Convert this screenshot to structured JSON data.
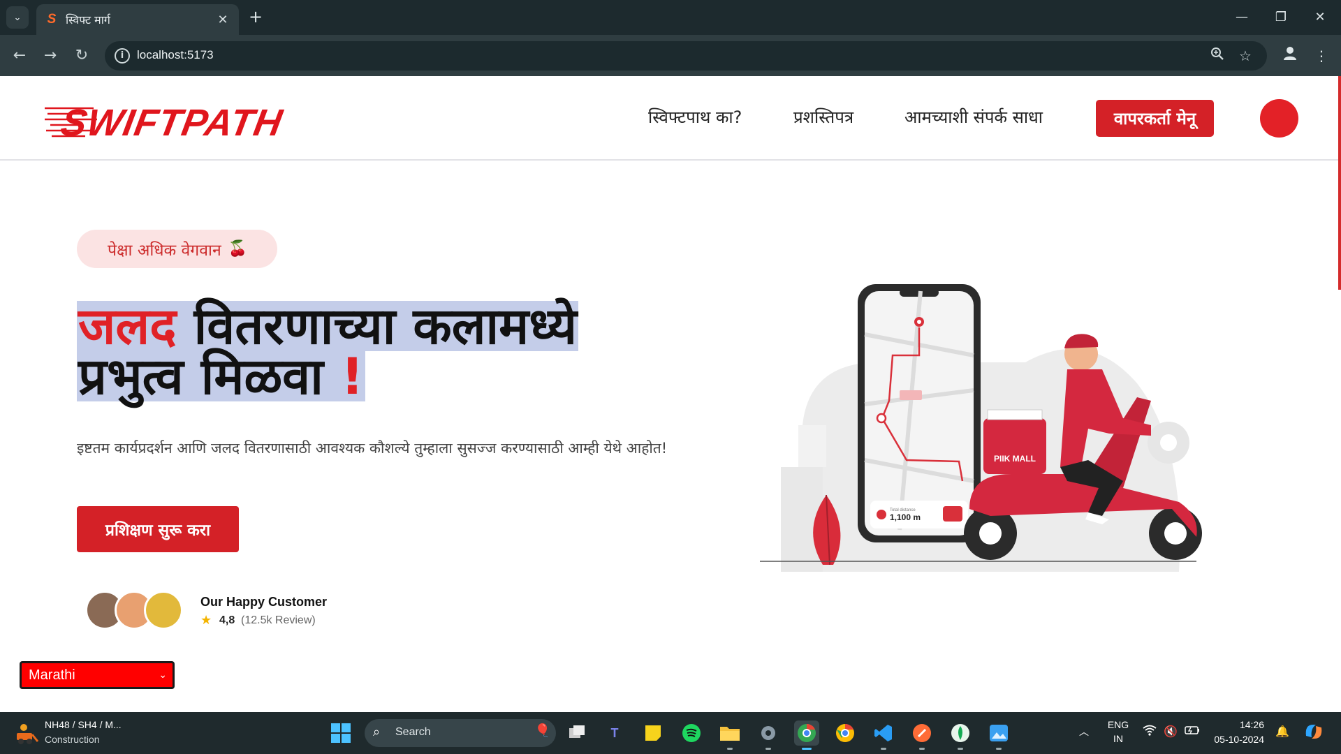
{
  "browser": {
    "tab_title": "स्विफ्ट मार्ग",
    "tab_favicon": "S",
    "url": "localhost:5173",
    "icons": [
      "tab-list-icon",
      "close-icon",
      "plus-icon",
      "back-icon",
      "forward-icon",
      "reload-icon",
      "info-icon",
      "zoom-icon",
      "star-icon",
      "profile-icon",
      "kebab-icon",
      "minimize-icon",
      "restore-icon",
      "window-close-icon"
    ]
  },
  "header": {
    "logo_text": "SWIFTPATH",
    "nav": [
      "स्विफ्टपाथ का?",
      "प्रशस्तिपत्र",
      "आमच्याशी संपर्क साधा"
    ],
    "menu_button": "वापरकर्ता मेनू"
  },
  "hero": {
    "badge": "पेक्षा अधिक वेगवान",
    "badge_icon": "🍒",
    "title_highlight": "जलद",
    "title_line1_rest": "वितरणाच्या कलामध्ये",
    "title_line2": "प्रभुत्व मिळवा",
    "title_exclaim": "!",
    "description": "इष्टतम कार्यप्रदर्शन आणि जलद वितरणासाठी आवश्यक कौशल्ये तुम्हाला सुसज्ज करण्यासाठी आम्ही येथे आहोत!",
    "cta": "प्रशिक्षण सुरू करा"
  },
  "customers": {
    "label": "Our Happy Customer",
    "rating": "4,8",
    "reviews": "(12.5k Review)"
  },
  "illustration": {
    "store_label": "PIIK MALL",
    "distance_label": "Total distance",
    "distance_value": "1,100 m"
  },
  "language_select": {
    "selected": "Marathi"
  },
  "taskbar": {
    "weather_title": "NH48 / SH4 / M...",
    "weather_sub": "Construction",
    "search_label": "Search",
    "lang_top": "ENG",
    "lang_bottom": "IN",
    "time": "14:26",
    "date": "05-10-2024"
  },
  "colors": {
    "brand_red": "#e0161d",
    "button_red": "#d42127",
    "selection_blue": "#c4cde9",
    "chrome_dark": "#1d2a2e",
    "taskbar": "#1f2a2d"
  }
}
